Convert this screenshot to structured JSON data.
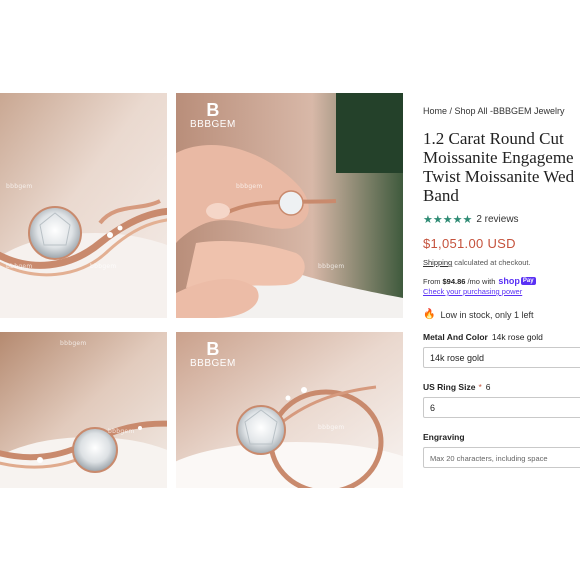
{
  "gallery": {
    "watermark": "bbbgem",
    "logo_text": "BBBGEM"
  },
  "product": {
    "breadcrumb": "Home / Shop All -BBBGEM Jewelry",
    "title_lines": [
      "1.2 Carat Round Cut",
      "Moissanite Engageme",
      "Twist Moissanite Wed",
      "Band"
    ],
    "rating_stars": "★★★★★",
    "reviews": "2 reviews",
    "price": "$1,051.00 USD",
    "shipping_link": "Shipping",
    "shipping_text": "calculated at checkout.",
    "shoppay_prefix": "From",
    "shoppay_amount": "$94.86",
    "shoppay_suffix": "/mo with",
    "shoppay_brand": "shop",
    "shoppay_badge": "Pay",
    "shoppay_link": "Check your purchasing power",
    "stock": "Low in stock, only 1 left"
  },
  "options": {
    "metal_label": "Metal And Color",
    "metal_value_label": "14k rose gold",
    "metal_selected": "14k rose gold",
    "size_label": "US Ring Size",
    "size_required": "*",
    "size_value_label": "6",
    "size_selected": "6",
    "engraving_label": "Engraving",
    "engraving_placeholder": "Max 20 characters, including space"
  },
  "colors": {
    "stars": "#2e8b74",
    "price": "#c5523c",
    "shoppay": "#5a31f4"
  }
}
